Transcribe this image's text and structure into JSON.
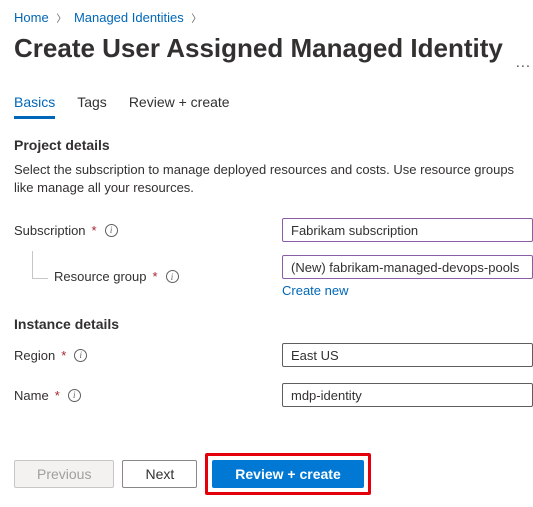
{
  "breadcrumb": {
    "home": "Home",
    "managed": "Managed Identities"
  },
  "title": "Create User Assigned Managed Identity",
  "tabs": {
    "basics": "Basics",
    "tags": "Tags",
    "review": "Review + create"
  },
  "project": {
    "heading": "Project details",
    "description": "Select the subscription to manage deployed resources and costs. Use resource groups like manage all your resources.",
    "subscription_label": "Subscription",
    "subscription_value": "Fabrikam subscription",
    "resource_group_label": "Resource group",
    "resource_group_value": "(New) fabrikam-managed-devops-pools",
    "create_new": "Create new"
  },
  "instance": {
    "heading": "Instance details",
    "region_label": "Region",
    "region_value": "East US",
    "name_label": "Name",
    "name_value": "mdp-identity"
  },
  "footer": {
    "previous": "Previous",
    "next": "Next",
    "review_create": "Review + create"
  }
}
